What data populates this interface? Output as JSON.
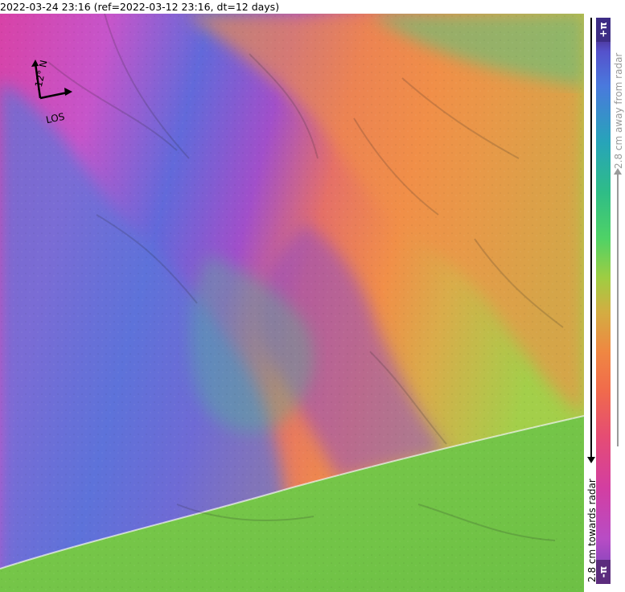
{
  "title": "2022-03-24 23:16 (ref=2022-03-12 23:16, dt=12 days)",
  "compass": {
    "north_label": "-12° N",
    "los_label": "LOS",
    "rotation_degrees": -12
  },
  "colorbar": {
    "top_label": "+π",
    "bottom_label": "-π",
    "away_label": "2.8 cm away from radar",
    "towards_label": "2.8 cm towards radar"
  },
  "map": {
    "interferogram_colors": {
      "purple": "#b84cc5",
      "magenta": "#d33ea1",
      "blue": "#4a79dd",
      "cyan": "#27a4b9",
      "green": "#4fd266",
      "yellow": "#d3ad42",
      "orange": "#ef8742",
      "coverage_edge_green": "#84c94a"
    }
  }
}
